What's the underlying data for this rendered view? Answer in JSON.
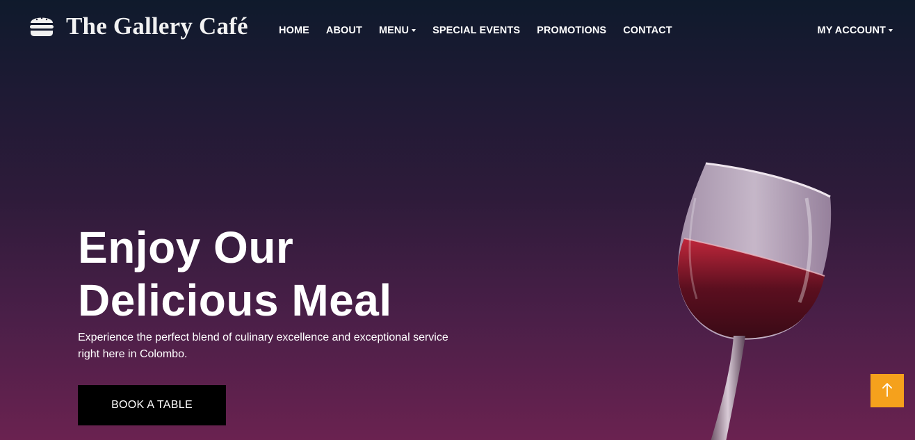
{
  "brand": {
    "name": "The Gallery Café",
    "icon": "burger-icon"
  },
  "nav": {
    "items": [
      {
        "label": "HOME"
      },
      {
        "label": "ABOUT"
      },
      {
        "label": "MENU",
        "dropdown": true
      },
      {
        "label": "SPECIAL EVENTS"
      },
      {
        "label": "PROMOTIONS"
      },
      {
        "label": "CONTACT"
      }
    ],
    "account": {
      "label": "MY ACCOUNT",
      "dropdown": true
    }
  },
  "hero": {
    "title_line1": "Enjoy Our",
    "title_line2": "Delicious Meal",
    "subtitle_line1": "Experience the perfect blend of culinary excellence and exceptional service",
    "subtitle_line2": "right here in Colombo.",
    "cta_label": "BOOK A TABLE",
    "image": "wine-glass-image"
  },
  "back_to_top": {
    "icon": "arrow-up-icon"
  },
  "colors": {
    "gradient_top": "#0f1a2c",
    "gradient_bottom": "#6a2250",
    "cta_background": "#000000",
    "back_to_top_background": "#f5a11c"
  }
}
